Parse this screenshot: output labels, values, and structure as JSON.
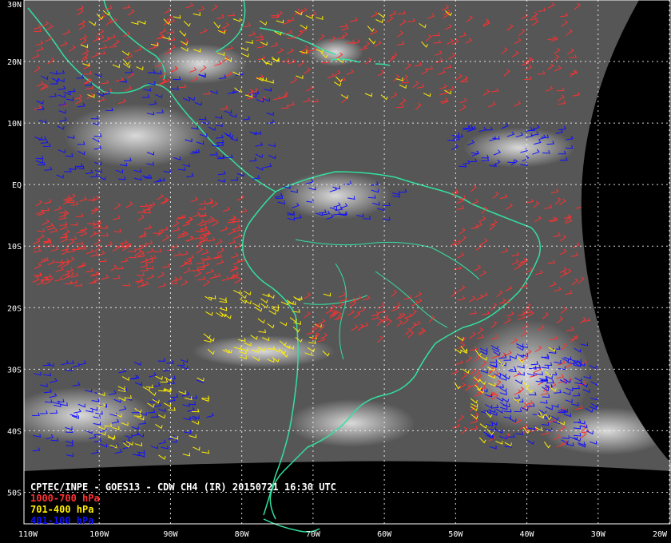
{
  "map": {
    "producer_line": "CPTEC/INPE - GOES13 - CDW CH4 (IR) 20150721 16:30 UTC",
    "legend": [
      {
        "label": "1000-700 hPa",
        "color": "#ff3030"
      },
      {
        "label": "701-400 hPa",
        "color": "#ffee00"
      },
      {
        "label": "401-100 hPa",
        "color": "#1010ff"
      }
    ],
    "colors": {
      "background": "#000000",
      "cloud_image": "#5a5a5a",
      "coastline": "#33e0a0",
      "grid": "#ffffff"
    },
    "lat_labels": [
      "30N",
      "20N",
      "10N",
      "EQ",
      "10S",
      "20S",
      "30S",
      "40S",
      "50S"
    ],
    "lon_labels": [
      "110W",
      "100W",
      "90W",
      "80W",
      "70W",
      "60W",
      "50W",
      "40W",
      "30W",
      "20W"
    ],
    "domain": {
      "lon_min": -110,
      "lon_max": -20,
      "lat_min": -55,
      "lat_max": 30
    }
  }
}
